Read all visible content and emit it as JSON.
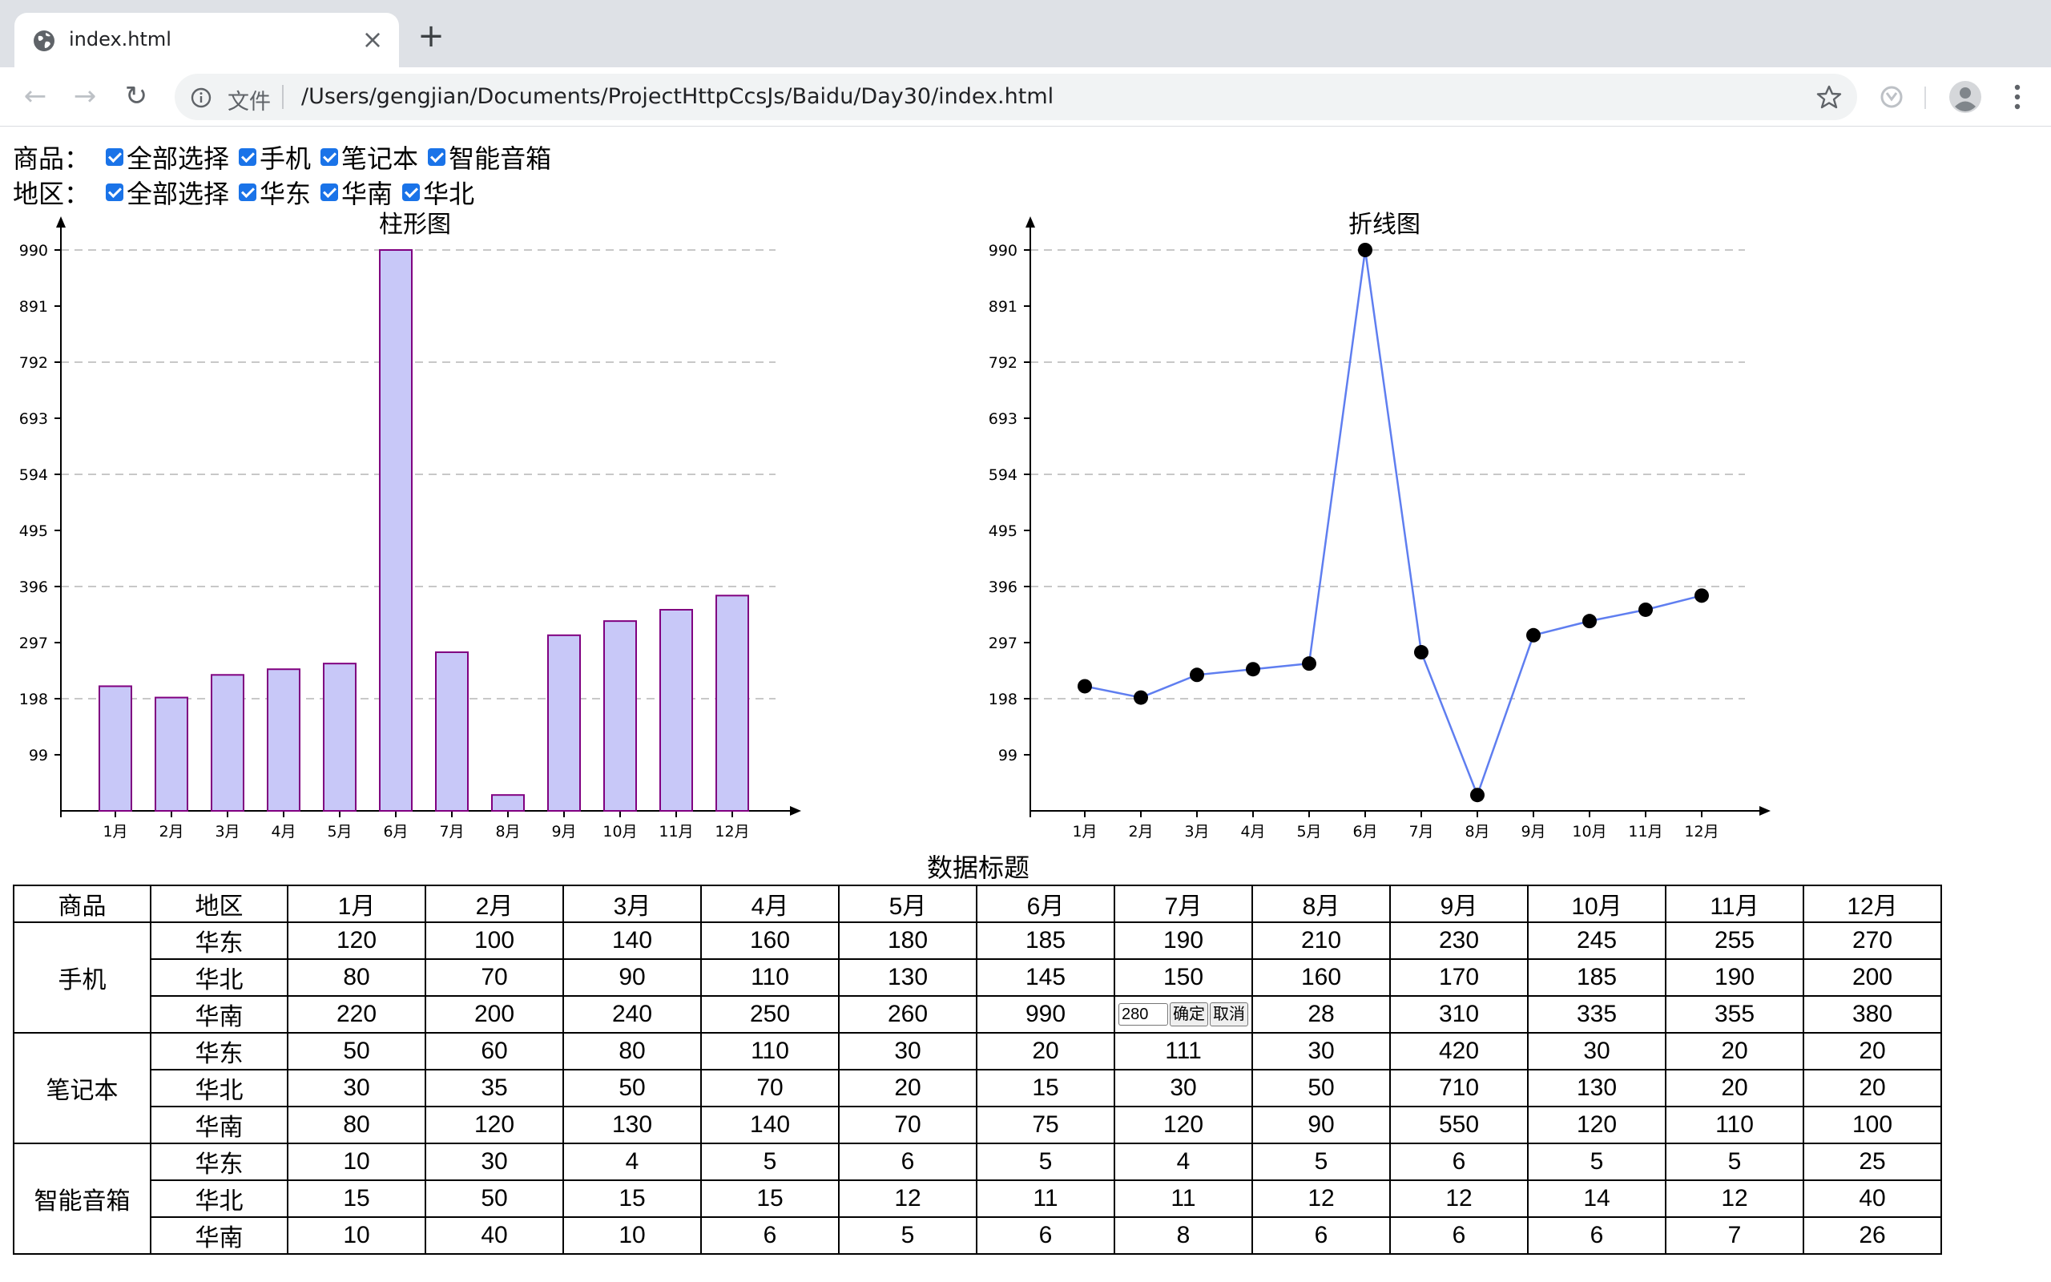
{
  "browser": {
    "tab_title": "index.html",
    "tab_close": "×",
    "new_tab": "+",
    "scheme_label": "文件",
    "url": "/Users/gengjian/Documents/ProjectHttpCcsJs/Baidu/Day30/index.html"
  },
  "filters": {
    "goods_label": "商品：",
    "goods_options": [
      "全部选择",
      "手机",
      "笔记本",
      "智能音箱"
    ],
    "region_label": "地区：",
    "region_options": [
      "全部选择",
      "华东",
      "华南",
      "华北"
    ]
  },
  "chart_data": [
    {
      "type": "bar",
      "title": "柱形图",
      "categories": [
        "1月",
        "2月",
        "3月",
        "4月",
        "5月",
        "6月",
        "7月",
        "8月",
        "9月",
        "10月",
        "11月",
        "12月"
      ],
      "values": [
        220,
        200,
        240,
        250,
        260,
        990,
        280,
        28,
        310,
        335,
        355,
        380
      ],
      "yticks": [
        99,
        198,
        297,
        396,
        495,
        594,
        693,
        792,
        891,
        990
      ],
      "ylim": [
        0,
        990
      ],
      "grid": true,
      "colors": {
        "fill": "#c8c8f8",
        "stroke": "#800080"
      }
    },
    {
      "type": "line",
      "title": "折线图",
      "categories": [
        "1月",
        "2月",
        "3月",
        "4月",
        "5月",
        "6月",
        "7月",
        "8月",
        "9月",
        "10月",
        "11月",
        "12月"
      ],
      "values": [
        220,
        200,
        240,
        250,
        260,
        990,
        280,
        28,
        310,
        335,
        355,
        380
      ],
      "yticks": [
        99,
        198,
        297,
        396,
        495,
        594,
        693,
        792,
        891,
        990
      ],
      "ylim": [
        0,
        990
      ],
      "grid": true,
      "colors": {
        "line": "#5f7ef0",
        "point": "#000000"
      }
    }
  ],
  "table": {
    "title": "数据标题",
    "headers": [
      "商品",
      "地区",
      "1月",
      "2月",
      "3月",
      "4月",
      "5月",
      "6月",
      "7月",
      "8月",
      "9月",
      "10月",
      "11月",
      "12月"
    ],
    "groups": [
      {
        "product": "手机",
        "rows": [
          {
            "region": "华东",
            "values": [
              "120",
              "100",
              "140",
              "160",
              "180",
              "185",
              "190",
              "210",
              "230",
              "245",
              "255",
              "270"
            ]
          },
          {
            "region": "华北",
            "values": [
              "80",
              "70",
              "90",
              "110",
              "130",
              "145",
              "150",
              "160",
              "170",
              "185",
              "190",
              "200"
            ]
          },
          {
            "region": "华南",
            "values": [
              "220",
              "200",
              "240",
              "250",
              "260",
              "990",
              "280",
              "28",
              "310",
              "335",
              "355",
              "380"
            ]
          }
        ]
      },
      {
        "product": "笔记本",
        "rows": [
          {
            "region": "华东",
            "values": [
              "50",
              "60",
              "80",
              "110",
              "30",
              "20",
              "111",
              "30",
              "420",
              "30",
              "20",
              "20"
            ]
          },
          {
            "region": "华北",
            "values": [
              "30",
              "35",
              "50",
              "70",
              "20",
              "15",
              "30",
              "50",
              "710",
              "130",
              "20",
              "20"
            ]
          },
          {
            "region": "华南",
            "values": [
              "80",
              "120",
              "130",
              "140",
              "70",
              "75",
              "120",
              "90",
              "550",
              "120",
              "110",
              "100"
            ]
          }
        ]
      },
      {
        "product": "智能音箱",
        "rows": [
          {
            "region": "华东",
            "values": [
              "10",
              "30",
              "4",
              "5",
              "6",
              "5",
              "4",
              "5",
              "6",
              "5",
              "5",
              "25"
            ]
          },
          {
            "region": "华北",
            "values": [
              "15",
              "50",
              "15",
              "15",
              "12",
              "11",
              "11",
              "12",
              "12",
              "14",
              "12",
              "40"
            ]
          },
          {
            "region": "华南",
            "values": [
              "10",
              "40",
              "10",
              "6",
              "5",
              "6",
              "8",
              "6",
              "6",
              "6",
              "7",
              "26"
            ]
          }
        ]
      }
    ],
    "editing": {
      "group": 0,
      "row": 2,
      "col": 6,
      "input_value": "280",
      "confirm_label": "确定",
      "cancel_label": "取消"
    }
  }
}
